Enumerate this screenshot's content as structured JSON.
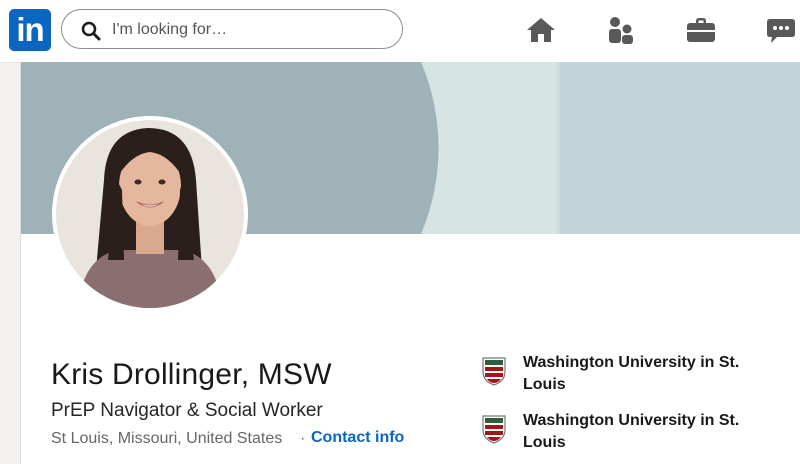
{
  "brand": {
    "logo_text": "in",
    "color": "#0a66c2"
  },
  "search": {
    "placeholder": "I'm looking for…"
  },
  "nav": {
    "icons": [
      "home-icon",
      "my-network-icon",
      "jobs-briefcase-icon",
      "messaging-icon"
    ]
  },
  "profile": {
    "name": "Kris Drollinger, MSW",
    "headline": "PrEP Navigator & Social Worker",
    "location": "St Louis, Missouri, United States",
    "separator": "·",
    "contact_label": "Contact info"
  },
  "education": [
    {
      "school": "Washington University in St. Louis",
      "icon": "university-crest-icon"
    },
    {
      "school": "Washington University in St. Louis",
      "icon": "university-crest-icon"
    }
  ],
  "colors": {
    "cover_dark": "#9eb2b8",
    "cover_light": "#d6e4e3",
    "cover_right": "#c0d3d8",
    "link": "#0a66c2",
    "crest_red": "#a51417"
  }
}
